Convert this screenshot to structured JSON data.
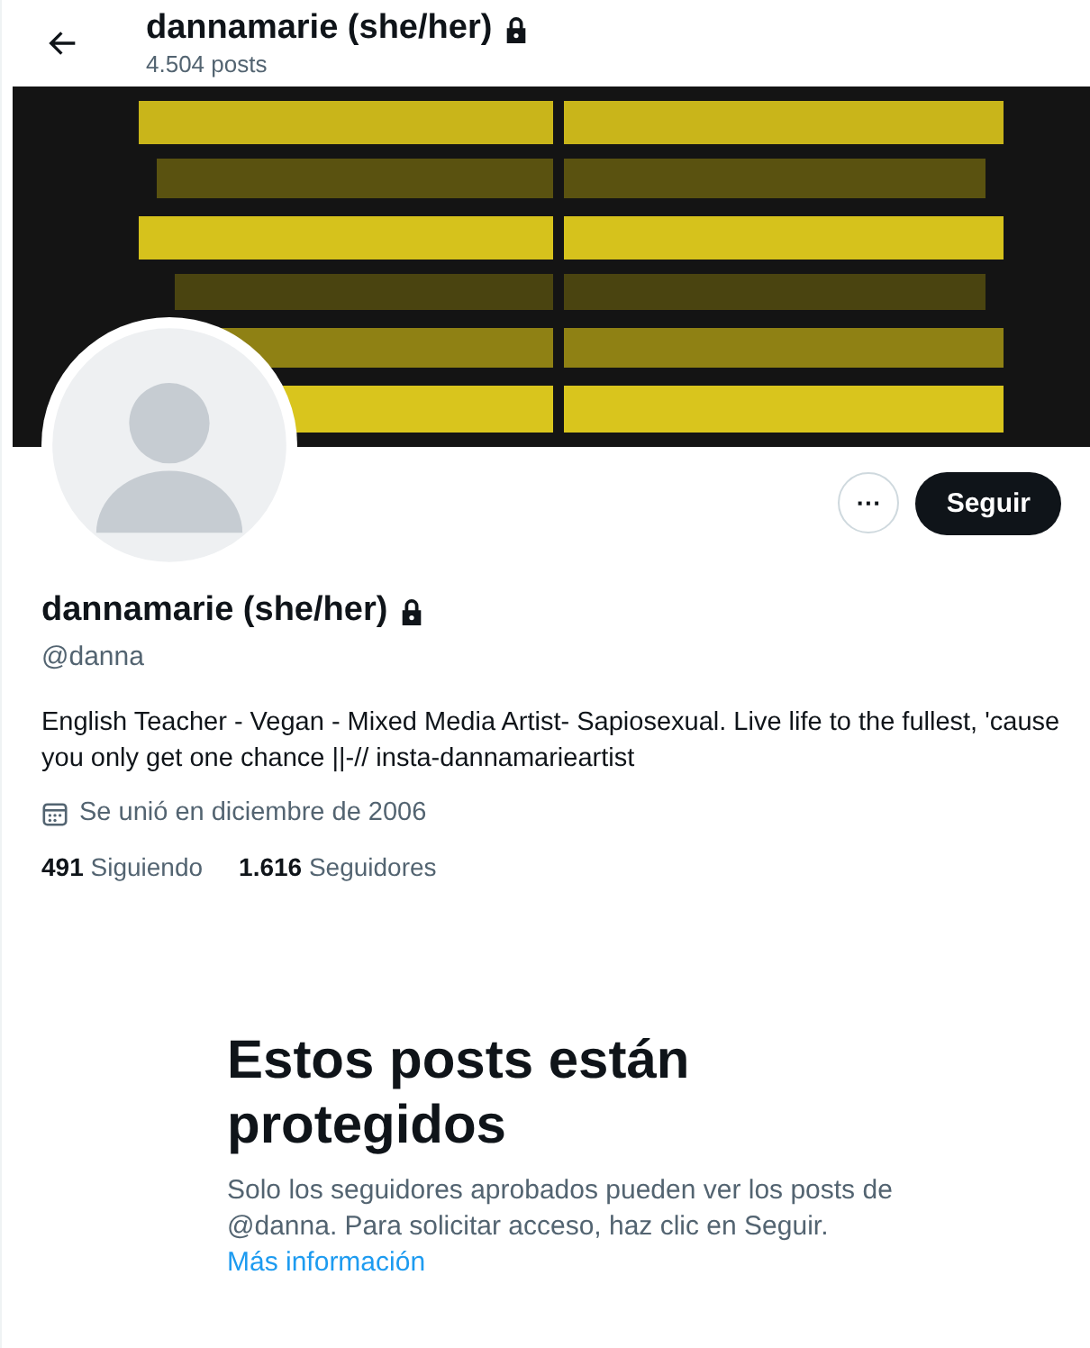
{
  "header": {
    "title": "dannamarie (she/her)",
    "locked": true,
    "post_count": "4.504 posts"
  },
  "actions": {
    "more": "···",
    "follow": "Seguir"
  },
  "profile": {
    "name": "dannamarie (she/her)",
    "locked": true,
    "handle": "@danna",
    "bio": "English Teacher - Vegan - Mixed Media Artist- Sapiosexual. Live life to the fullest, 'cause you only get one chance ||-// insta-dannamarieartist",
    "joined": "Se unió en diciembre de 2006",
    "stats": [
      {
        "count": "491",
        "label": "Siguiendo"
      },
      {
        "count": "1.616",
        "label": "Seguidores"
      }
    ]
  },
  "protected": {
    "heading": "Estos posts están protegidos",
    "text": "Solo los seguidores aprobados pueden ver los posts de @danna. Para solicitar acceso, haz clic en Seguir.",
    "link": "Más información"
  }
}
